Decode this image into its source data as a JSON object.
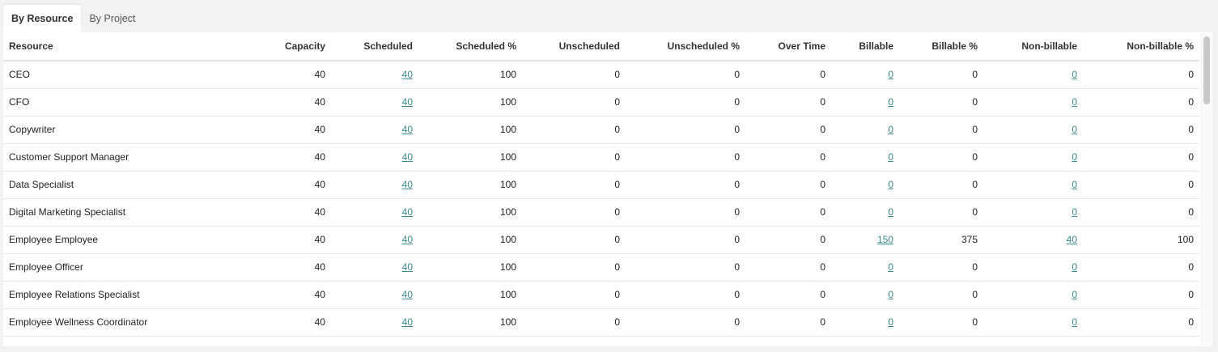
{
  "tabs": [
    {
      "label": "By Resource",
      "active": true
    },
    {
      "label": "By Project",
      "active": false
    }
  ],
  "colors": {
    "link": "#3a8a8a",
    "scrollbar_thumb": "#c8c8c8"
  },
  "table": {
    "columns": [
      "Resource",
      "Capacity",
      "Scheduled",
      "Scheduled %",
      "Unscheduled",
      "Unscheduled %",
      "Over Time",
      "Billable",
      "Billable %",
      "Non-billable",
      "Non-billable %"
    ],
    "rows": [
      [
        "CEO",
        "40",
        "40",
        "100",
        "0",
        "0",
        "0",
        "0",
        "0",
        "0",
        "0"
      ],
      [
        "CFO",
        "40",
        "40",
        "100",
        "0",
        "0",
        "0",
        "0",
        "0",
        "0",
        "0"
      ],
      [
        "Copywriter",
        "40",
        "40",
        "100",
        "0",
        "0",
        "0",
        "0",
        "0",
        "0",
        "0"
      ],
      [
        "Customer Support Manager",
        "40",
        "40",
        "100",
        "0",
        "0",
        "0",
        "0",
        "0",
        "0",
        "0"
      ],
      [
        "Data Specialist",
        "40",
        "40",
        "100",
        "0",
        "0",
        "0",
        "0",
        "0",
        "0",
        "0"
      ],
      [
        "Digital Marketing Specialist",
        "40",
        "40",
        "100",
        "0",
        "0",
        "0",
        "0",
        "0",
        "0",
        "0"
      ],
      [
        "Employee Employee",
        "40",
        "40",
        "100",
        "0",
        "0",
        "0",
        "150",
        "375",
        "40",
        "100"
      ],
      [
        "Employee Officer",
        "40",
        "40",
        "100",
        "0",
        "0",
        "0",
        "0",
        "0",
        "0",
        "0"
      ],
      [
        "Employee Relations Specialist",
        "40",
        "40",
        "100",
        "0",
        "0",
        "0",
        "0",
        "0",
        "0",
        "0"
      ],
      [
        "Employee Wellness Coordinator",
        "40",
        "40",
        "100",
        "0",
        "0",
        "0",
        "0",
        "0",
        "0",
        "0"
      ],
      [
        "",
        "",
        "",
        "",
        "",
        "",
        "",
        "",
        "",
        "",
        ""
      ]
    ]
  }
}
